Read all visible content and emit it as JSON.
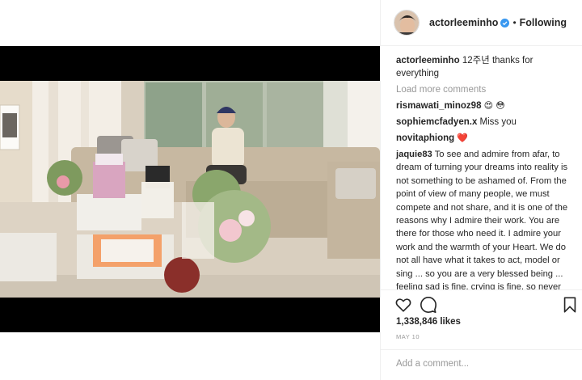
{
  "header": {
    "username": "actorleeminho",
    "separator": "•",
    "follow_status": "Following"
  },
  "caption": {
    "username": "actorleeminho",
    "text": "12주년 thanks for everything"
  },
  "load_more": "Load more comments",
  "comments": [
    {
      "username": "rismawati_minoz98",
      "text": "😍 😳"
    },
    {
      "username": "sophiemcfadyen.x",
      "text": "Miss you"
    },
    {
      "username": "novitaphiong",
      "text": "❤️"
    },
    {
      "username": "jaquie83",
      "text": "To see and admire from afar, to dream of turning your dreams into reality is not something to be ashamed of. From the point of view of many people, we must compete and not share, and it is one of the reasons why I admire their work. You are there for those who need it. I admire your work and the warmth of your Heart. We do not all have what it takes to act, model or sing ... so you are a very blessed being ... feeling sad is fine, crying is fine, so never feel afraid to express your feelings. Every moment tells us that we should thank God"
    }
  ],
  "likes": "1,338,846 likes",
  "date": "MAY 10",
  "add_comment_placeholder": "Add a comment...",
  "icons": {
    "like": "heart-icon",
    "comment": "comment-icon",
    "save": "bookmark-icon",
    "verified": "verified-badge-icon"
  },
  "colors": {
    "verified": "#3897f0",
    "muted": "#999999",
    "text": "#262626"
  }
}
